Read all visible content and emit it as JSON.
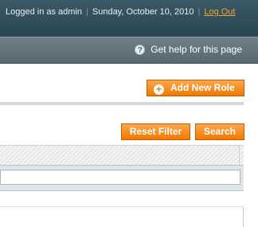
{
  "header": {
    "logged_in": "Logged in as admin",
    "separator": "|",
    "date": "Sunday, October 10, 2010",
    "logout": "Log Out"
  },
  "subbar": {
    "help_glyph": "?",
    "help_text": "Get help for this page"
  },
  "actions": {
    "add_new_role": "Add New Role",
    "add_glyph": "+"
  },
  "grid": {
    "reset_filter": "Reset Filter",
    "search": "Search",
    "filter_value": ""
  },
  "colors": {
    "header_bg": "#2f4c57",
    "accent_orange": "#f07900",
    "logout_link": "#f0a82e"
  }
}
